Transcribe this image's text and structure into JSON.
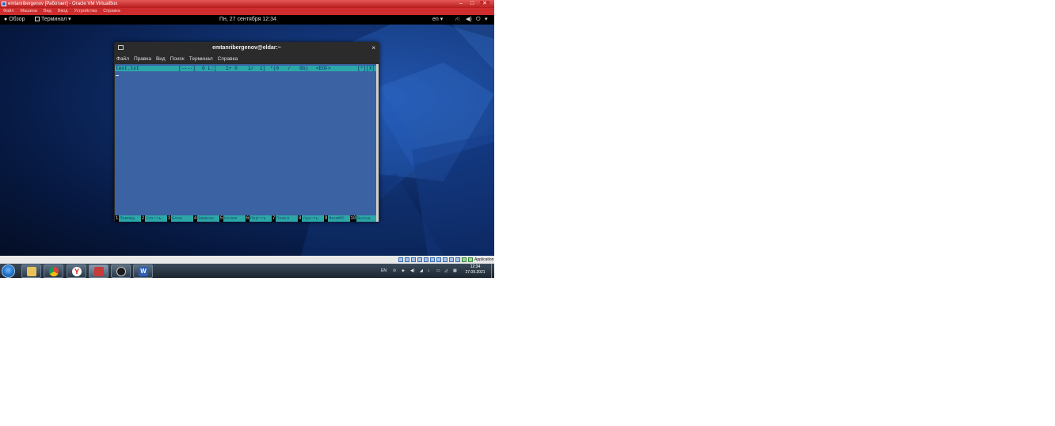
{
  "vbox": {
    "title": "emtanribergenov [Работает] - Oracle VM VirtualBox",
    "window_controls": [
      "–",
      "□",
      "✕"
    ],
    "menu": [
      "Файл",
      "Машина",
      "Вид",
      "Ввод",
      "Устройства",
      "Справка"
    ],
    "status_text": "Application",
    "status_icons": [
      "hdd-icon",
      "optical-drive-icon",
      "audio-icon",
      "network-icon",
      "usb-icon",
      "shared-folder-icon",
      "display-icon",
      "recording-icon",
      "cpu-icon",
      "mouse-integration-icon",
      "host-key-icon"
    ]
  },
  "gnome": {
    "activities": "Обзор",
    "app_menu": "Терминал",
    "datetime": "Пн, 27 сентября  12:34",
    "language": "en",
    "tray_icons": [
      "network-icon",
      "volume-icon",
      "power-icon",
      "chevron-down-icon"
    ]
  },
  "terminal": {
    "title": "emtanribergenov@eldar:~",
    "close": "×",
    "menu": [
      "Файл",
      "Правка",
      "Вид",
      "Поиск",
      "Терминал",
      "Справка"
    ],
    "status": {
      "filename": "text.txt",
      "mode": "[----]",
      "col": "0 L:[",
      "line": "1+ 0",
      "pos": "1/  1]",
      "bytes": "*(0   /   0b)",
      "eof": "<EOF>",
      "flags": "[*][X]"
    },
    "fkeys": [
      {
        "num": "1",
        "label": "Помощь"
      },
      {
        "num": "2",
        "label": "Сох~ть"
      },
      {
        "num": "3",
        "label": "Блок"
      },
      {
        "num": "4",
        "label": "Замена"
      },
      {
        "num": "5",
        "label": "Копия"
      },
      {
        "num": "6",
        "label": "Пер~ть"
      },
      {
        "num": "7",
        "label": "Поиск"
      },
      {
        "num": "8",
        "label": "Уда~ть"
      },
      {
        "num": "9",
        "label": "МенюМС"
      },
      {
        "num": "10",
        "label": "Выход"
      }
    ]
  },
  "taskbar": {
    "apps": [
      "explorer-icon",
      "chrome-icon",
      "yandex-browser-icon",
      "virtualbox-icon",
      "clock-app-icon",
      "word-icon"
    ],
    "language": "EN",
    "time": "12:34",
    "date": "27.09.2021"
  }
}
